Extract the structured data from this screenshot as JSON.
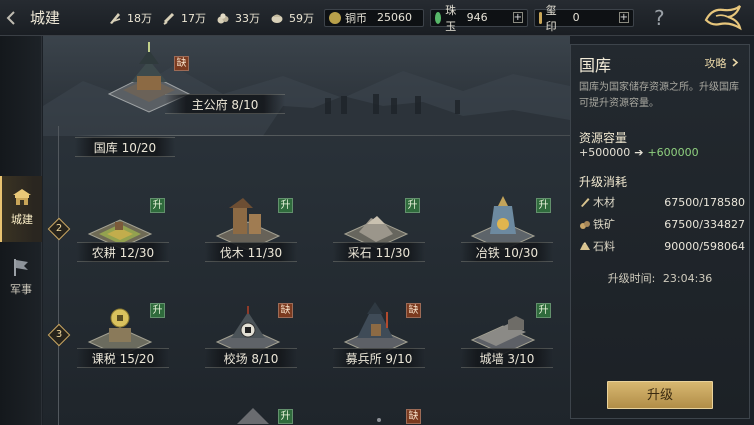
{
  "header": {
    "title": "城建",
    "resources": [
      {
        "icon": "wood-icon",
        "value": "18万"
      },
      {
        "icon": "iron-icon",
        "value": "17万"
      },
      {
        "icon": "stone-icon",
        "value": "33万"
      },
      {
        "icon": "food-icon",
        "value": "59万"
      }
    ],
    "currencies": [
      {
        "icon": "copper-coin-icon",
        "label": "铜币",
        "value": "25060",
        "color": "#b8a04a",
        "plus": false
      },
      {
        "icon": "jade-icon",
        "label": "珠玉",
        "value": "946",
        "color": "#58b86a",
        "plus": true,
        "plus_label": "+"
      },
      {
        "icon": "seal-icon",
        "label": "玺印",
        "value": "0",
        "color": "#c9a658",
        "plus": true,
        "plus_label": "+"
      }
    ],
    "help_label": "?"
  },
  "rail": {
    "tabs": [
      {
        "label": "城建",
        "icon": "city-building-icon",
        "active": true
      },
      {
        "label": "军事",
        "icon": "military-flag-icon",
        "active": false
      }
    ]
  },
  "main": {
    "palace": {
      "label": "主公府 8/10",
      "tag": "缺"
    },
    "treasury_label": "国库 10/20",
    "tiers": [
      {
        "num": "2",
        "buildings": [
          {
            "label": "农耕 12/30",
            "tag": "升",
            "tag_type": "up",
            "icon": "farm-building-icon"
          },
          {
            "label": "伐木 11/30",
            "tag": "升",
            "tag_type": "up",
            "icon": "lumber-building-icon"
          },
          {
            "label": "采石 11/30",
            "tag": "升",
            "tag_type": "up",
            "icon": "quarry-building-icon"
          },
          {
            "label": "冶铁 10/30",
            "tag": "升",
            "tag_type": "up",
            "icon": "smelter-building-icon"
          }
        ]
      },
      {
        "num": "3",
        "buildings": [
          {
            "label": "课税 15/20",
            "tag": "升",
            "tag_type": "up",
            "icon": "tax-building-icon"
          },
          {
            "label": "校场 8/10",
            "tag": "缺",
            "tag_type": "miss",
            "icon": "drill-ground-icon"
          },
          {
            "label": "募兵所 9/10",
            "tag": "缺",
            "tag_type": "miss",
            "icon": "recruit-building-icon"
          },
          {
            "label": "城墙 3/10",
            "tag": "升",
            "tag_type": "up",
            "icon": "wall-building-icon"
          }
        ]
      }
    ],
    "partial_tags": [
      {
        "tag": "升",
        "tag_type": "up"
      },
      {
        "tag": "缺",
        "tag_type": "miss"
      }
    ]
  },
  "panel": {
    "title": "国库",
    "guide_label": "攻略",
    "description": "国库为国家储存资源之所。升级国库可提升资源容量。",
    "capacity_title": "资源容量",
    "capacity_from": "+500000",
    "capacity_arrow": "➔",
    "capacity_to": "+600000",
    "cost_title": "升级消耗",
    "costs": [
      {
        "icon": "wood-icon",
        "name": "木材",
        "amount": "67500/178580"
      },
      {
        "icon": "iron-icon",
        "name": "铁矿",
        "amount": "67500/334827"
      },
      {
        "icon": "stone-icon",
        "name": "石料",
        "amount": "90000/598064"
      }
    ],
    "time_label": "升级时间:",
    "time_value": "23:04:36",
    "upgrade_label": "升级"
  }
}
